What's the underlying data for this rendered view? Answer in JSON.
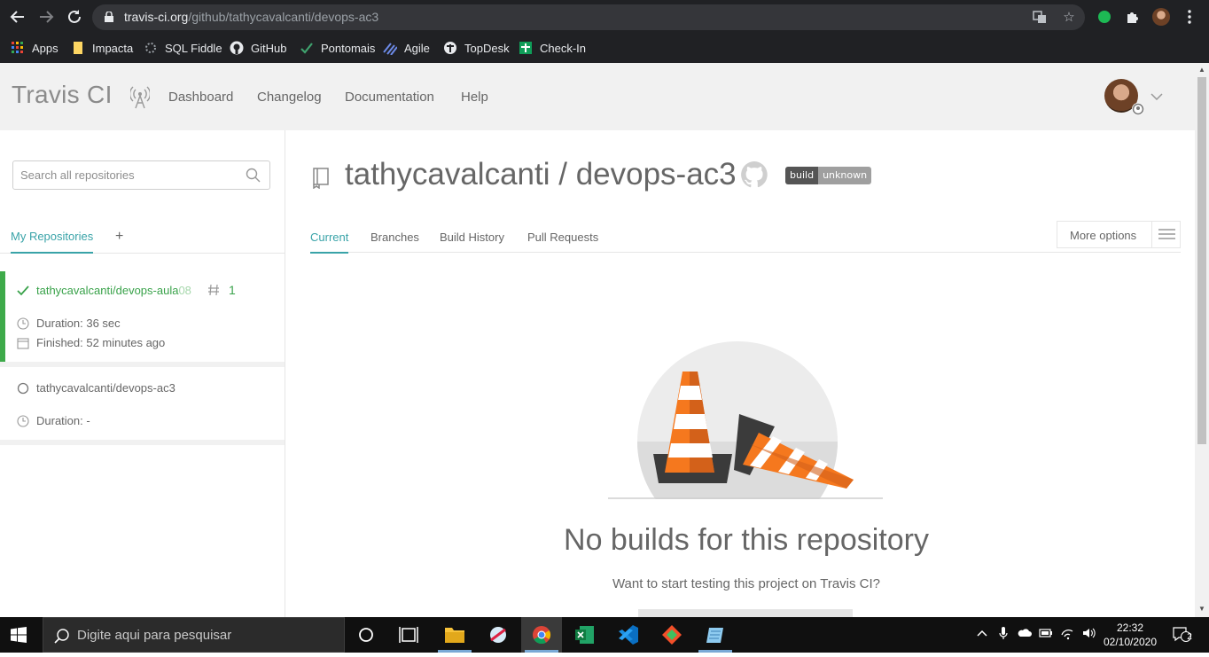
{
  "browser": {
    "url_host": "travis-ci.org",
    "url_path": "/github/tathycavalcanti/devops-ac3",
    "bookmarks": [
      {
        "label": "Apps",
        "icon": "apps-grid-icon"
      },
      {
        "label": "Impacta",
        "icon": "folder-icon"
      },
      {
        "label": "SQL Fiddle",
        "icon": "sql-fiddle-icon"
      },
      {
        "label": "GitHub",
        "icon": "github-icon"
      },
      {
        "label": "Pontomais",
        "icon": "pontomais-icon"
      },
      {
        "label": "Agile",
        "icon": "agile-icon"
      },
      {
        "label": "TopDesk",
        "icon": "topdesk-icon"
      },
      {
        "label": "Check-In",
        "icon": "check-in-icon"
      }
    ]
  },
  "header": {
    "logo": "Travis CI",
    "nav": [
      "Dashboard",
      "Changelog",
      "Documentation",
      "Help"
    ]
  },
  "sidebar": {
    "search_placeholder": "Search all repositories",
    "tab_label": "My Repositories",
    "add_label": "+",
    "repos": [
      {
        "name": "tathycavalcanti/devops-aula",
        "name_fade": "08",
        "build_number": "1",
        "duration": "Duration: 36 sec",
        "finished": "Finished: 52 minutes ago",
        "status": "passed"
      },
      {
        "name": "tathycavalcanti/devops-ac3",
        "duration": "Duration: -",
        "status": "none"
      }
    ]
  },
  "main": {
    "title": "tathycavalcanti / devops-ac3",
    "badge_left": "build",
    "badge_right": "unknown",
    "tabs": [
      "Current",
      "Branches",
      "Build History",
      "Pull Requests"
    ],
    "more_options": "More options",
    "empty_title": "No builds for this repository",
    "empty_sub": "Want to start testing this project on Travis CI?"
  },
  "taskbar": {
    "search_placeholder": "Digite aqui para pesquisar",
    "time": "22:32",
    "date": "02/10/2020",
    "notifications": "2"
  },
  "colors": {
    "accent_teal": "#39a3a8",
    "passed_green": "#3eaa4a",
    "cone_orange": "#f5781e"
  }
}
